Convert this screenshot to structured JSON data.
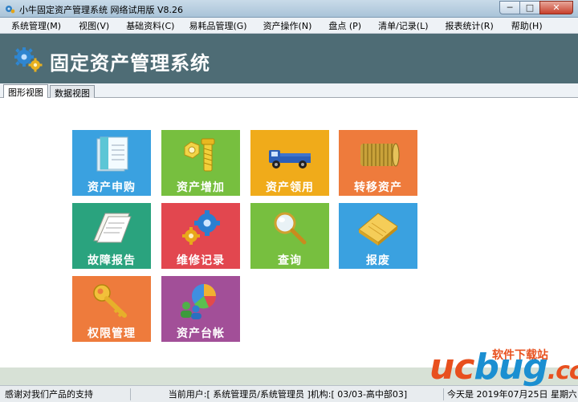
{
  "window": {
    "title": "小牛固定资产管理系统 网络试用版 V8.26",
    "buttons": {
      "minimize": "─",
      "maximize": "□",
      "close": "✕"
    }
  },
  "menu": [
    "系统管理(M)",
    "视图(V)",
    "基础资料(C)",
    "易耗品管理(G)",
    "资产操作(N)",
    "盘点 (P)",
    "清单/记录(L)",
    "报表统计(R)",
    "帮助(H)"
  ],
  "banner": {
    "title": "固定资产管理系统"
  },
  "tabs": [
    "图形视图",
    "数据视图"
  ],
  "tiles": [
    {
      "label": "资产申购",
      "color": "#3aa1e0",
      "icon": "document-stack-icon"
    },
    {
      "label": "资产增加",
      "color": "#77bf3f",
      "icon": "bolt-nut-icon"
    },
    {
      "label": "资产领用",
      "color": "#f0ab1a",
      "icon": "truck-icon"
    },
    {
      "label": "转移资产",
      "color": "#ee7b3c",
      "icon": "coin-stack-icon"
    },
    {
      "label": "故障报告",
      "color": "#2aa37e",
      "icon": "open-document-icon"
    },
    {
      "label": "维修记录",
      "color": "#e2474f",
      "icon": "gears-icon"
    },
    {
      "label": "查询",
      "color": "#77bf3f",
      "icon": "magnifier-icon"
    },
    {
      "label": "报废",
      "color": "#3aa1e0",
      "icon": "notepad-icon"
    },
    {
      "label": "权限管理",
      "color": "#ee7b3c",
      "icon": "key-icon"
    },
    {
      "label": "资产台帐",
      "color": "#a24f98",
      "icon": "pie-chart-users-icon"
    }
  ],
  "status": {
    "message": "感谢对我们产品的支持",
    "user": "当前用户:[ 系统管理员/系统管理员 ]机构:[ 03/03-高中部03]",
    "date": "今天是 2019年07月25日   星期六"
  },
  "watermark": {
    "uc": "uc",
    "bug": "bug",
    "cc": ".cc",
    "site": "软件下载站"
  }
}
